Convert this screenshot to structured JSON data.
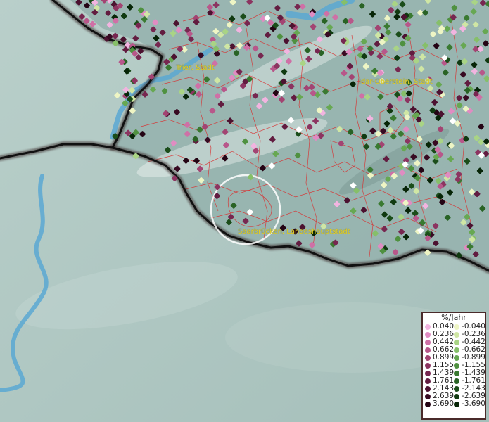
{
  "map": {
    "places": [
      {
        "name": "Trier, Stadt"
      },
      {
        "name": "Idar-Oberstein, Stadt"
      },
      {
        "name": "Saarbrücken, Landeshauptstadt"
      }
    ]
  },
  "legend": {
    "title": "%/Jahr",
    "positive": [
      {
        "label": "0.040",
        "color": "#f2b4e0"
      },
      {
        "label": "0.236",
        "color": "#e08cc2"
      },
      {
        "label": "0.442",
        "color": "#cf70a6"
      },
      {
        "label": "0.662",
        "color": "#b8578a"
      },
      {
        "label": "0.899",
        "color": "#a34472"
      },
      {
        "label": "1.155",
        "color": "#8c3460"
      },
      {
        "label": "1.439",
        "color": "#772750"
      },
      {
        "label": "1.761",
        "color": "#621c40"
      },
      {
        "label": "2.143",
        "color": "#4c1230"
      },
      {
        "label": "2.639",
        "color": "#380a22"
      },
      {
        "label": "3.690",
        "color": "#240414"
      }
    ],
    "negative": [
      {
        "label": "-0.040",
        "color": "#eef5c4"
      },
      {
        "label": "-0.236",
        "color": "#cfe6a4"
      },
      {
        "label": "-0.442",
        "color": "#a9d485"
      },
      {
        "label": "-0.662",
        "color": "#86bf69"
      },
      {
        "label": "-0.899",
        "color": "#67a852"
      },
      {
        "label": "-1.155",
        "color": "#4f9140"
      },
      {
        "label": "-1.439",
        "color": "#3a7a31"
      },
      {
        "label": "-1.761",
        "color": "#296325"
      },
      {
        "label": "-2.143",
        "color": "#1b4d1a"
      },
      {
        "label": "-2.639",
        "color": "#103a10"
      },
      {
        "label": "-3.690",
        "color": "#072507"
      }
    ]
  }
}
